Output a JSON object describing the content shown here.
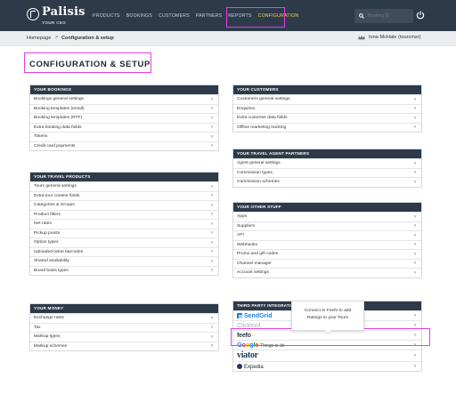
{
  "brand": {
    "name": "Palisis",
    "subtitle": "YOUR CEO"
  },
  "nav": {
    "items": [
      {
        "label": "PRODUCTS"
      },
      {
        "label": "BOOKINGS"
      },
      {
        "label": "CUSTOMERS"
      },
      {
        "label": "PARTNERS"
      },
      {
        "label": "REPORTS"
      },
      {
        "label": "CONFIGURATION"
      }
    ],
    "active": "CONFIGURATION",
    "search_placeholder": "Booking ID"
  },
  "breadcrumb": {
    "home": "Homepage",
    "separator": ">",
    "current": "Configuration & setup"
  },
  "user": {
    "name": "Iona McHale (tourcmsr)"
  },
  "page_title": "CONFIGURATION & SETUP",
  "panels": {
    "your_bookings": {
      "title": "YOUR BOOKINGS",
      "items": [
        "Bookings general settings",
        "Booking templates (email)",
        "Booking templates (RTF)",
        "Extra booking data fields",
        "Tokens",
        "Credit card payments"
      ]
    },
    "your_travel_products": {
      "title": "YOUR TRAVEL PRODUCTS",
      "items": [
        "Tours general settings",
        "Extra tour content fields",
        "Categories & Groups",
        "Product filters",
        "Net rates",
        "Pickup points",
        "Option types",
        "Uploaded ticket barcodes",
        "Shared availability",
        "Board basis types"
      ]
    },
    "your_money": {
      "title": "YOUR MONEY",
      "items": [
        "Exchange rates",
        "Tax",
        "Markup types",
        "Markup schemes"
      ]
    },
    "your_customers": {
      "title": "YOUR CUSTOMERS",
      "items": [
        "Customers general settings",
        "Enquiries",
        "Extra customer data fields",
        "Offline marketing tracking"
      ]
    },
    "your_travel_agent_partners": {
      "title": "YOUR TRAVEL AGENT PARTNERS",
      "items": [
        "Agent general settings",
        "Commission types",
        "Commission schemes"
      ]
    },
    "your_other_stuff": {
      "title": "YOUR OTHER STUFF",
      "items": [
        "Apps",
        "Suppliers",
        "API",
        "Webhooks",
        "Promo and gift codes",
        "Channel manager",
        "Account settings"
      ]
    },
    "third_party": {
      "title": "THIRD PARTY INTEGRATIONS",
      "logos": {
        "sendgrid": "SendGrid",
        "clicktool": "Clicktool",
        "feefo": "feefo",
        "google_word": "Google",
        "google_tag": "Things to do",
        "viator": "viator",
        "expedia": "Expedia"
      }
    }
  },
  "tooltip": {
    "line1": "Connect to Feefo to add",
    "line2": "Ratings to your Tours"
  },
  "colors": {
    "navbar": "#2d3a4a",
    "highlight": "#e43fe0",
    "active_nav": "#f4d44d"
  }
}
